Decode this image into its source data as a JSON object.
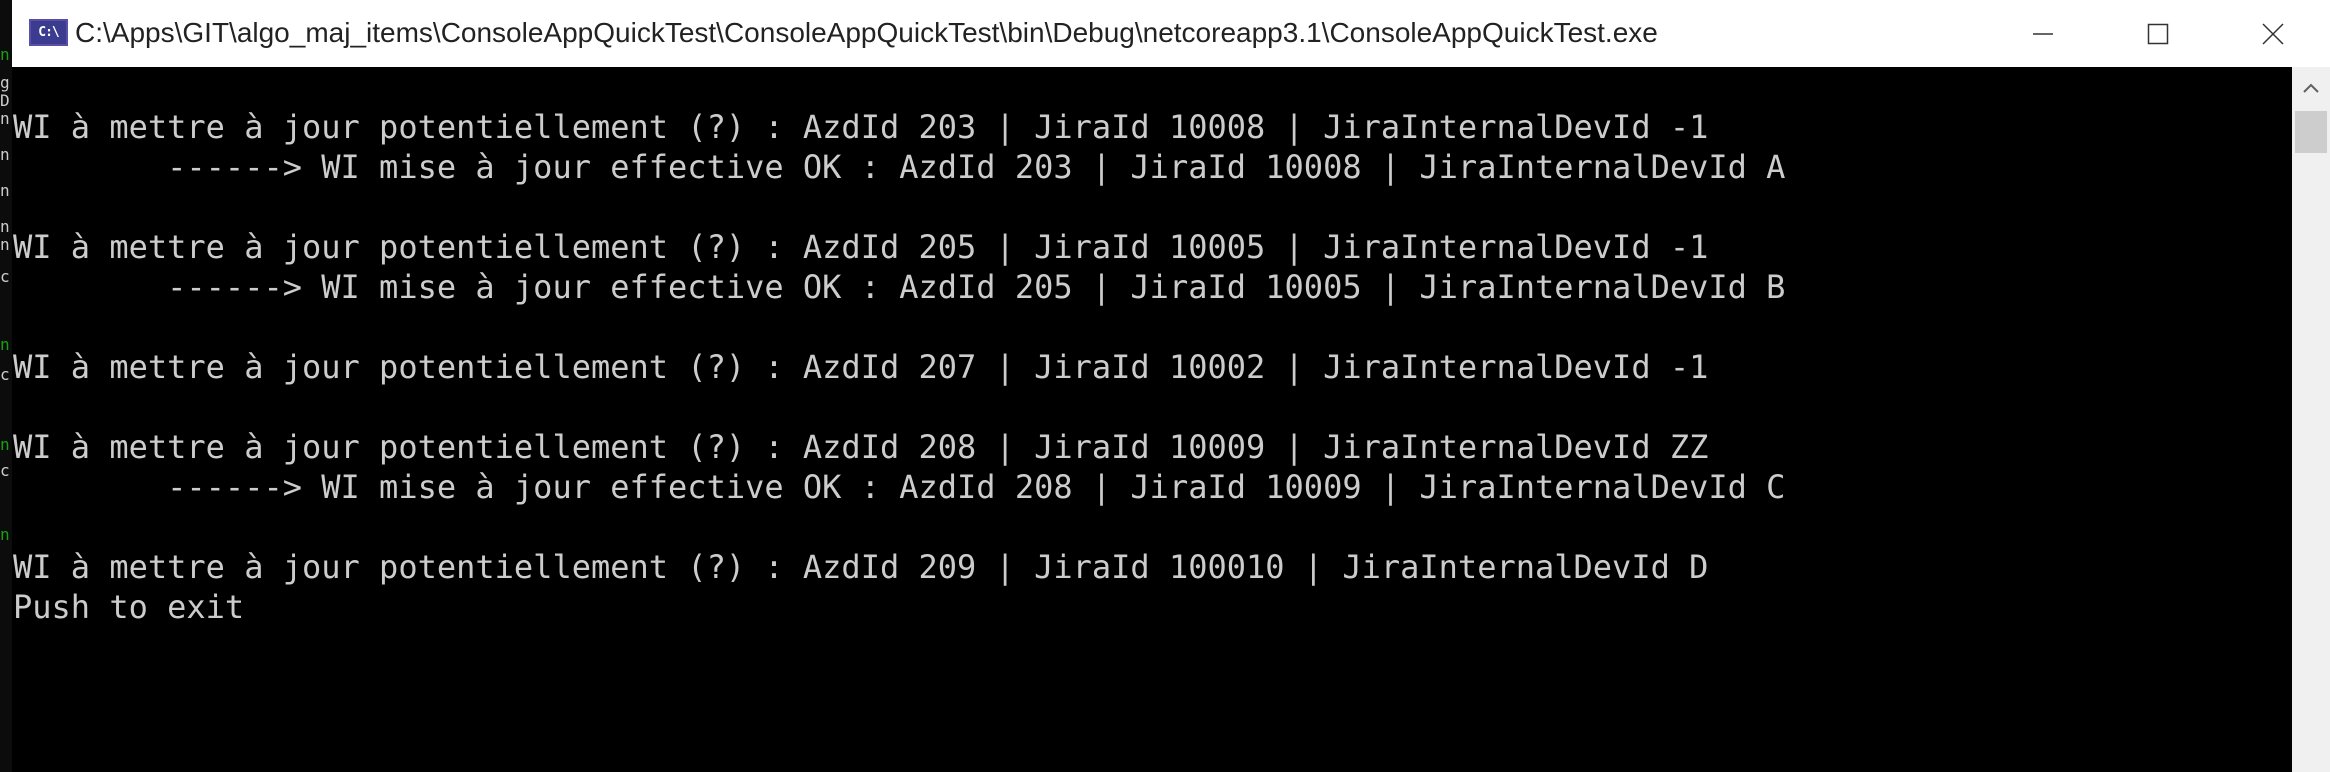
{
  "window": {
    "title": "C:\\Apps\\GIT\\algo_maj_items\\ConsoleAppQuickTest\\ConsoleAppQuickTest\\bin\\Debug\\netcoreapp3.1\\ConsoleAppQuickTest.exe",
    "icon": "console-app-icon",
    "icon_text": "C:\\",
    "controls": {
      "minimize": "minimize-icon",
      "maximize": "maximize-icon",
      "close": "close-icon"
    }
  },
  "console": {
    "background": "#000000",
    "foreground": "#cccccc",
    "lines": [
      "WI à mettre à jour potentiellement (?) : AzdId 203 | JiraId 10008 | JiraInternalDevId -1",
      "        ------> WI mise à jour effective OK : AzdId 203 | JiraId 10008 | JiraInternalDevId A",
      "",
      "WI à mettre à jour potentiellement (?) : AzdId 205 | JiraId 10005 | JiraInternalDevId -1",
      "        ------> WI mise à jour effective OK : AzdId 205 | JiraId 10005 | JiraInternalDevId B",
      "",
      "WI à mettre à jour potentiellement (?) : AzdId 207 | JiraId 10002 | JiraInternalDevId -1",
      "",
      "WI à mettre à jour potentiellement (?) : AzdId 208 | JiraId 10009 | JiraInternalDevId ZZ",
      "        ------> WI mise à jour effective OK : AzdId 208 | JiraId 10009 | JiraInternalDevId C",
      "",
      "WI à mettre à jour potentiellement (?) : AzdId 209 | JiraId 100010 | JiraInternalDevId D",
      "Push to exit"
    ]
  },
  "scrollbar": {
    "up_arrow": "chevron-up-icon"
  }
}
